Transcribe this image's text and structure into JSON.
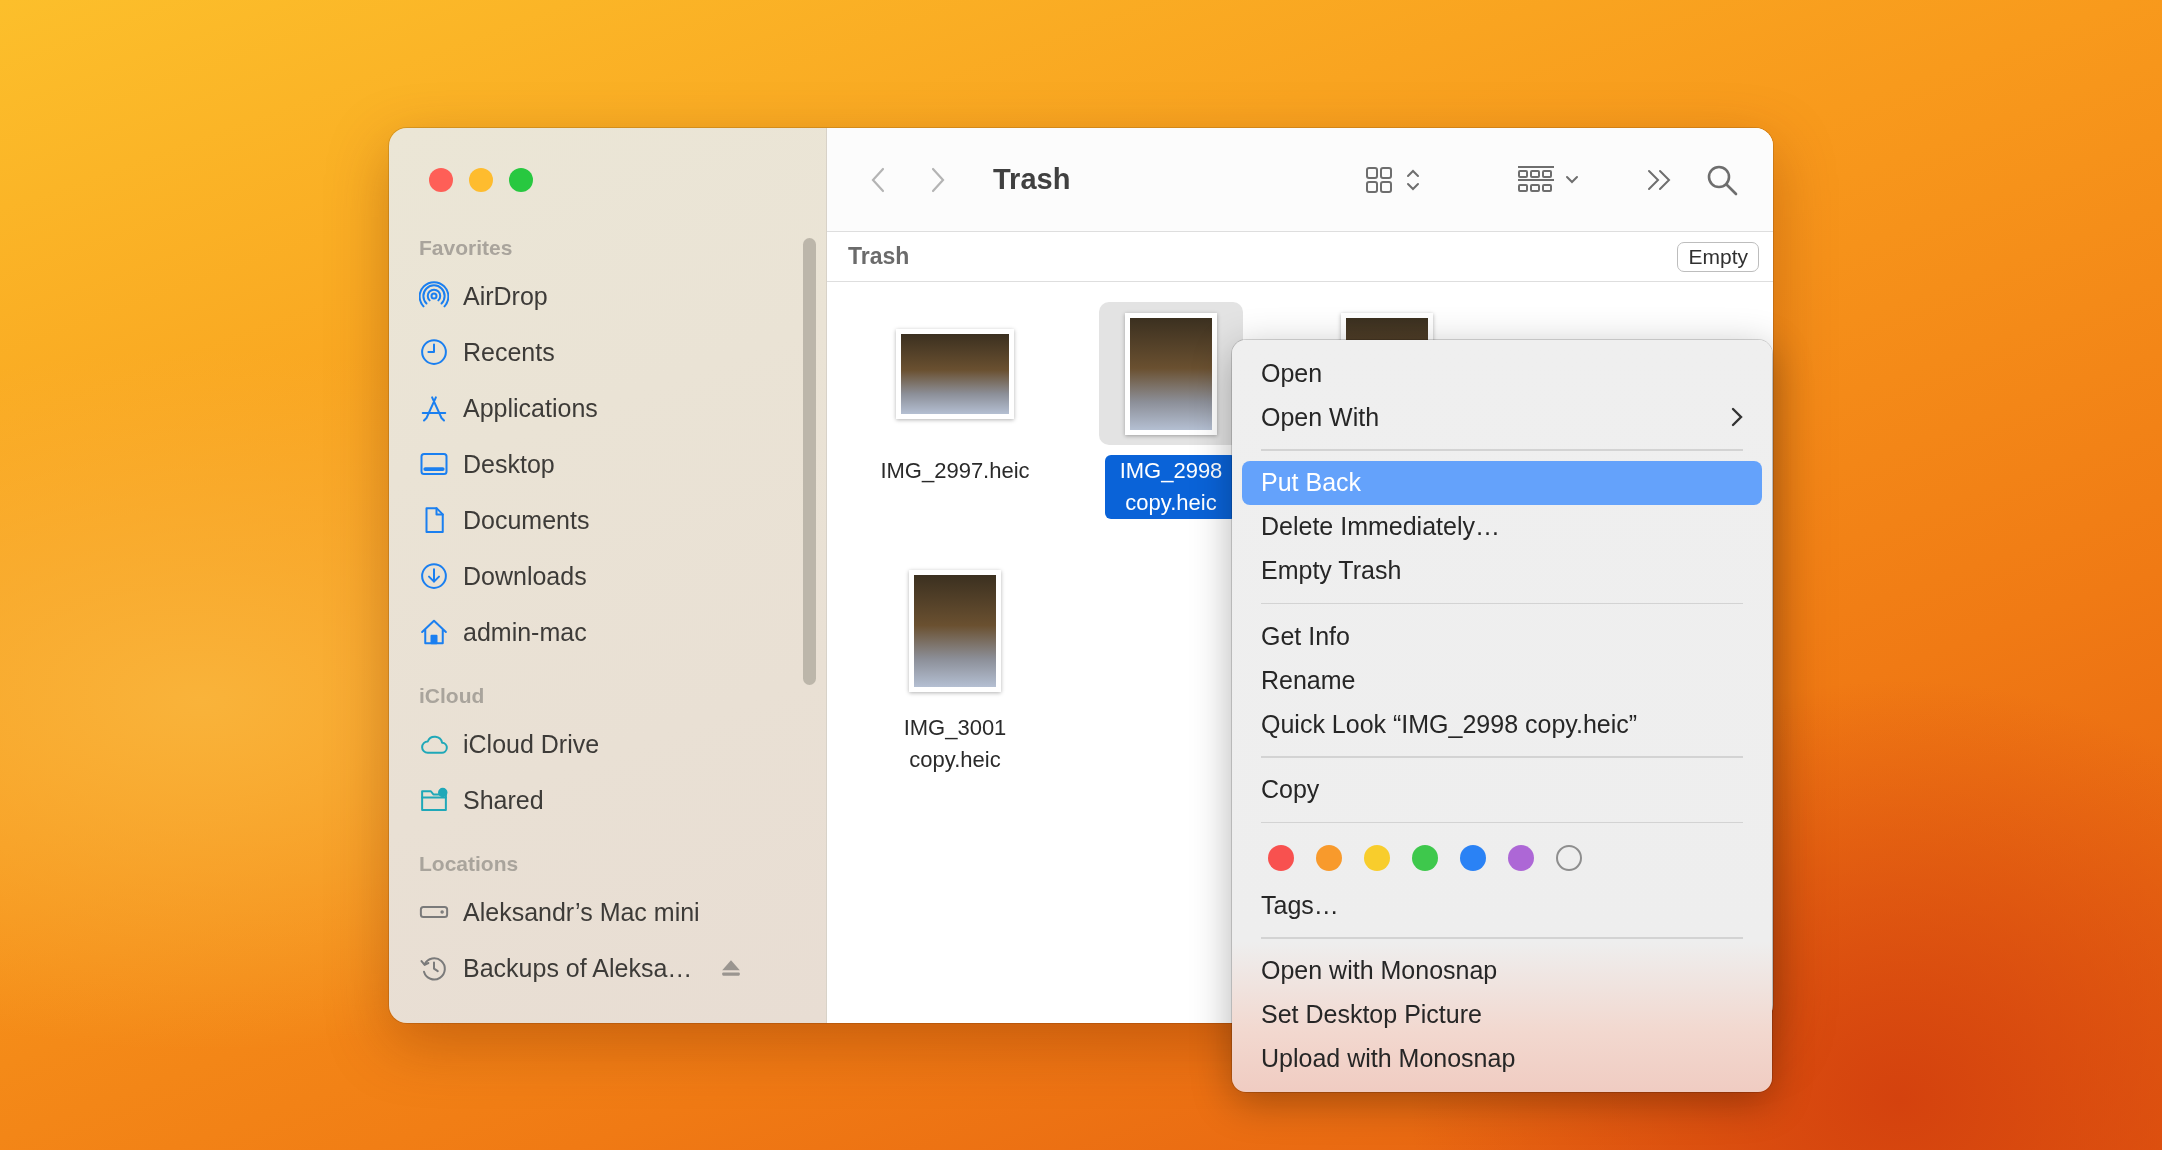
{
  "window": {
    "title": "Trash"
  },
  "sidebar": {
    "sections": [
      {
        "title": "Favorites",
        "items": [
          {
            "label": "AirDrop",
            "kind": "airdrop"
          },
          {
            "label": "Recents",
            "kind": "recents"
          },
          {
            "label": "Applications",
            "kind": "applications"
          },
          {
            "label": "Desktop",
            "kind": "desktop"
          },
          {
            "label": "Documents",
            "kind": "documents"
          },
          {
            "label": "Downloads",
            "kind": "downloads"
          },
          {
            "label": "admin-mac",
            "kind": "home"
          }
        ]
      },
      {
        "title": "iCloud",
        "items": [
          {
            "label": "iCloud Drive",
            "kind": "cloud"
          },
          {
            "label": "Shared",
            "kind": "shared"
          }
        ]
      },
      {
        "title": "Locations",
        "items": [
          {
            "label": "Aleksandr’s Mac mini",
            "kind": "drive"
          },
          {
            "label": "Backups of Aleksa…",
            "kind": "backup",
            "ejectable": true
          }
        ]
      }
    ]
  },
  "path_bar": {
    "title": "Trash",
    "button": "Empty"
  },
  "files": [
    {
      "name": "IMG_2997.heic",
      "kind": "landscape",
      "selected": false
    },
    {
      "name": "IMG_2998 copy.heic",
      "kind": "portrait",
      "selected": true
    },
    {
      "kind": "portrait",
      "selected": false
    },
    {
      "name": "IMG_3001 copy.heic",
      "kind": "portrait",
      "selected": false
    }
  ],
  "context_menu": {
    "items": [
      {
        "kind": "item",
        "label": "Open",
        "selected": false
      },
      {
        "kind": "submenu",
        "label": "Open With",
        "selected": false
      },
      {
        "kind": "separator"
      },
      {
        "kind": "item",
        "label": "Put Back",
        "selected": true
      },
      {
        "kind": "item",
        "label": "Delete Immediately…",
        "selected": false
      },
      {
        "kind": "item",
        "label": "Empty Trash",
        "selected": false
      },
      {
        "kind": "separator"
      },
      {
        "kind": "item",
        "label": "Get Info",
        "selected": false
      },
      {
        "kind": "item",
        "label": "Rename",
        "selected": false
      },
      {
        "kind": "item",
        "label": "Quick Look “IMG_2998 copy.heic”",
        "selected": false
      },
      {
        "kind": "separator"
      },
      {
        "kind": "item",
        "label": "Copy",
        "selected": false
      },
      {
        "kind": "separator"
      },
      {
        "kind": "tags",
        "tags": [
          {
            "kind": "color",
            "color": "#f8514f"
          },
          {
            "kind": "color",
            "color": "#f89a2c"
          },
          {
            "kind": "color",
            "color": "#f8cd2c"
          },
          {
            "kind": "color",
            "color": "#3ec84c"
          },
          {
            "kind": "color",
            "color": "#2a82f5"
          },
          {
            "kind": "color",
            "color": "#ad67d6"
          },
          {
            "kind": "none"
          }
        ]
      },
      {
        "kind": "item",
        "label": "Tags…",
        "selected": false
      },
      {
        "kind": "separator"
      },
      {
        "kind": "item",
        "label": "Open with Monosnap",
        "selected": false
      },
      {
        "kind": "item",
        "label": "Set Desktop Picture",
        "selected": false
      },
      {
        "kind": "item",
        "label": "Upload with Monosnap",
        "selected": false
      }
    ]
  }
}
